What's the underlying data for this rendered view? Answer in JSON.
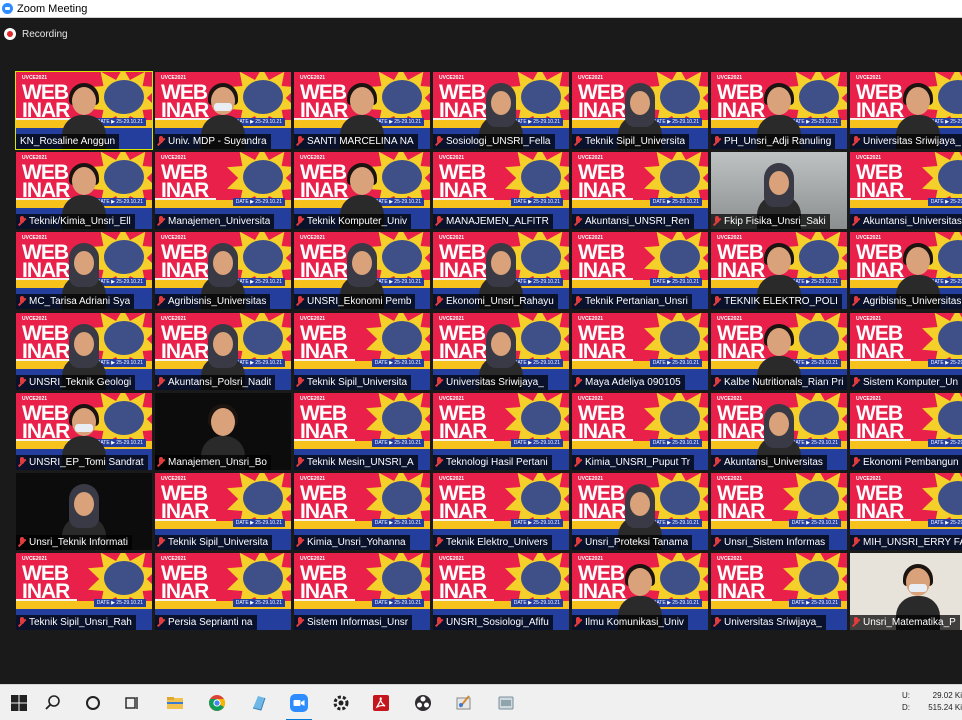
{
  "window": {
    "title": "Zoom Meeting"
  },
  "recording": {
    "label": "Recording"
  },
  "participants": [
    {
      "name": "KN_Rosaline Anggun",
      "muted": false,
      "active": true,
      "bg": "poster",
      "person": "woman"
    },
    {
      "name": "Univ. MDP - Suyandra",
      "muted": true,
      "bg": "poster",
      "person": "mask"
    },
    {
      "name": "SANTI MARCELINA NA",
      "muted": true,
      "bg": "poster",
      "person": "woman"
    },
    {
      "name": "Sosiologi_UNSRI_Fella",
      "muted": true,
      "bg": "poster",
      "person": "hijab"
    },
    {
      "name": "Teknik Sipil_Universita",
      "muted": true,
      "bg": "poster",
      "person": "hijab"
    },
    {
      "name": "PH_Unsri_Adji Ranuling",
      "muted": true,
      "bg": "poster",
      "person": "man"
    },
    {
      "name": "Universitas Sriwijaya_",
      "muted": true,
      "bg": "poster",
      "person": "woman"
    },
    {
      "name": "Teknik/Kimia_Unsri_Ell",
      "muted": true,
      "bg": "poster",
      "person": "woman"
    },
    {
      "name": "Manajemen_Universita",
      "muted": true,
      "bg": "poster",
      "person": "none"
    },
    {
      "name": "Teknik Komputer_Univ",
      "muted": true,
      "bg": "poster",
      "person": "man"
    },
    {
      "name": "MANAJEMEN_ALFITR",
      "muted": true,
      "bg": "poster",
      "person": "none"
    },
    {
      "name": "Akuntansi_UNSRI_Ren",
      "muted": true,
      "bg": "poster",
      "person": "none"
    },
    {
      "name": "Fkip Fisika_Unsri_Saki",
      "muted": true,
      "bg": "room",
      "person": "hijab"
    },
    {
      "name": "Akuntansi_Universitas",
      "muted": true,
      "bg": "poster",
      "person": "none"
    },
    {
      "name": "MC_Tarisa Adriani Sya",
      "muted": true,
      "bg": "poster",
      "person": "hijab"
    },
    {
      "name": "Agribisnis_Universitas",
      "muted": true,
      "bg": "poster",
      "person": "hijab"
    },
    {
      "name": "UNSRI_Ekonomi Pemb",
      "muted": true,
      "bg": "poster",
      "person": "hijab"
    },
    {
      "name": "Ekonomi_Unsri_Rahayu",
      "muted": true,
      "bg": "poster",
      "person": "hijab"
    },
    {
      "name": "Teknik Pertanian_Unsri",
      "muted": true,
      "bg": "poster",
      "person": "none"
    },
    {
      "name": "TEKNIK ELEKTRO_POLI",
      "muted": true,
      "bg": "poster",
      "person": "man"
    },
    {
      "name": "Agribisnis_Universitas",
      "muted": true,
      "bg": "poster",
      "person": "man"
    },
    {
      "name": "UNSRI_Teknik Geologi",
      "muted": true,
      "bg": "poster",
      "person": "hijab"
    },
    {
      "name": "Akuntansi_Polsri_Nadit",
      "muted": true,
      "bg": "poster",
      "person": "hijab"
    },
    {
      "name": "Teknik Sipil_Universita",
      "muted": true,
      "bg": "poster",
      "person": "none"
    },
    {
      "name": "Universitas Sriwijaya_",
      "muted": true,
      "bg": "poster",
      "person": "hijab"
    },
    {
      "name": "Maya Adeliya 090105",
      "muted": true,
      "bg": "poster",
      "person": "none"
    },
    {
      "name": "Kalbe Nutritionals_Rian Pri",
      "muted": true,
      "bg": "poster",
      "person": "man"
    },
    {
      "name": "Sistem Komputer_Un",
      "muted": true,
      "bg": "poster",
      "person": "none"
    },
    {
      "name": "UNSRI_EP_Tomi Sandrat",
      "muted": true,
      "bg": "poster",
      "person": "mask"
    },
    {
      "name": "Manajemen_Unsri_Bo",
      "muted": true,
      "bg": "dark",
      "person": "man"
    },
    {
      "name": "Teknik Mesin_UNSRI_A",
      "muted": true,
      "bg": "poster",
      "person": "none"
    },
    {
      "name": "Teknologi Hasil Pertani",
      "muted": true,
      "bg": "poster",
      "person": "none"
    },
    {
      "name": "Kimia_UNSRI_Puput Tr",
      "muted": true,
      "bg": "poster",
      "person": "none"
    },
    {
      "name": "Akuntansi_Universitas",
      "muted": true,
      "bg": "poster",
      "person": "hijab"
    },
    {
      "name": "Ekonomi Pembangun",
      "muted": true,
      "bg": "poster",
      "person": "none"
    },
    {
      "name": "Unsri_Teknik Informati",
      "muted": true,
      "bg": "dark",
      "person": "hijab"
    },
    {
      "name": "Teknik Sipil_Universita",
      "muted": true,
      "bg": "poster",
      "person": "none"
    },
    {
      "name": "Kimia_Unsri_Yohanna",
      "muted": true,
      "bg": "poster",
      "person": "none"
    },
    {
      "name": "Teknik Elektro_Univers",
      "muted": true,
      "bg": "poster",
      "person": "none"
    },
    {
      "name": "Unsri_Proteksi Tanama",
      "muted": true,
      "bg": "poster",
      "person": "hijab"
    },
    {
      "name": "Unsri_Sistem Informas",
      "muted": true,
      "bg": "poster",
      "person": "none"
    },
    {
      "name": "MIH_UNSRI_ERRY FA",
      "muted": true,
      "bg": "poster",
      "person": "none"
    },
    {
      "name": "Teknik Sipil_Unsri_Rah",
      "muted": true,
      "bg": "poster",
      "person": "none"
    },
    {
      "name": "Persia Seprianti na",
      "muted": true,
      "bg": "poster",
      "person": "none"
    },
    {
      "name": "Sistem Informasi_Unsr",
      "muted": true,
      "bg": "poster",
      "person": "none"
    },
    {
      "name": "UNSRI_Sosiologi_Afifu",
      "muted": true,
      "bg": "poster",
      "person": "none"
    },
    {
      "name": "Ilmu Komunikasi_Univ",
      "muted": true,
      "bg": "poster",
      "person": "woman"
    },
    {
      "name": "Universitas Sriwijaya_",
      "muted": true,
      "bg": "poster",
      "person": "none"
    },
    {
      "name": "Unsri_Matematika_P",
      "muted": true,
      "bg": "light",
      "person": "mask"
    }
  ],
  "poster": {
    "headline_1": "WEB",
    "headline_2": "INAR",
    "event": "UVCE2021",
    "date": "DATE ▶ 25-29.10.21"
  },
  "taskbar": {
    "items": [
      "windows-start-icon",
      "search-icon",
      "cortana-icon",
      "task-view-icon",
      "file-explorer-icon",
      "chrome-icon",
      "app-icon",
      "zoom-icon",
      "settings-icon",
      "acrobat-icon",
      "obs-icon",
      "paint-icon",
      "app2-icon"
    ],
    "network": {
      "upload_label": "U:",
      "upload_value": "29.02 Ki",
      "download_label": "D:",
      "download_value": "515.24 Ki"
    }
  }
}
